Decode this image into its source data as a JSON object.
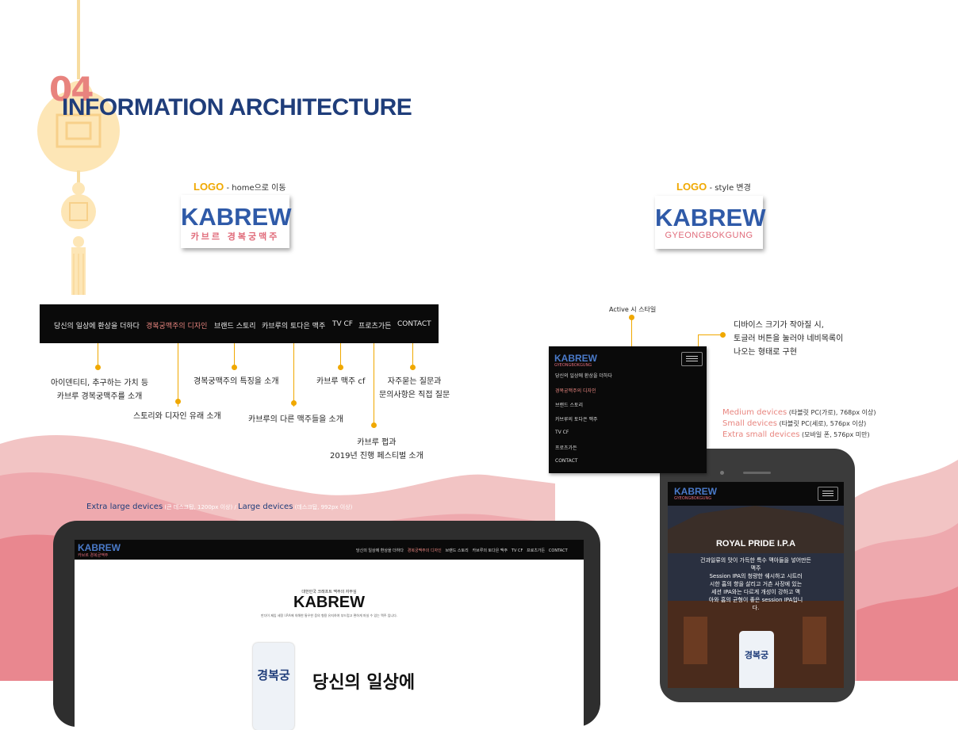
{
  "section": {
    "number": "04",
    "title": "INFORMATION ARCHITECTURE"
  },
  "logo_left": {
    "caption_label": "LOGO",
    "caption_text": " - home으로 이동",
    "main": "KABREW",
    "sub": "카브르 경복궁맥주"
  },
  "logo_right": {
    "caption_label": "LOGO",
    "caption_text": " - style 변경",
    "main": "KABREW",
    "sub": "GYEONGBOKGUNG"
  },
  "nav": {
    "items": [
      "당신의 일상에 환상을 더하다",
      "경복궁맥주의 디자인",
      "브랜드 스토리",
      "카브루의 토다은 맥주",
      "TV CF",
      "프로츠가든",
      "CONTACT"
    ],
    "active_index": 1
  },
  "annotations": {
    "a1_l1": "아이덴티티, 추구하는 가치 등",
    "a1_l2": "카브루 경복궁맥주를 소개",
    "a2": "스토리와 디자인 유래 소개",
    "a3": "경복궁맥주의 특징을 소개",
    "a4": "카브루의 다른 맥주들을 소개",
    "a5": "카브루 맥주 cf",
    "a6_l1": "카브루 펍과",
    "a6_l2": "2019년 진행 페스티벌 소개",
    "a7_l1": "자주묻는 질문과",
    "a7_l2": "문의사항은 직접 질문"
  },
  "mobile": {
    "active_label": "Active 시 스타일",
    "toggle_note_l1": "디바이스 크기가 작아질 시,",
    "toggle_note_l2": "토글러 버튼을 눌러야 네비목록이",
    "toggle_note_l3": "나오는 형태로 구현",
    "logo": "KABREW",
    "logo_sub": "GYEONGBOKGUNG",
    "items": [
      "당신의 일상에 환상을 더하다",
      "경복궁맥주의 디자인",
      "브랜드 스토리",
      "카브루의 토다은 맥주",
      "TV CF",
      "프로츠가든",
      "CONTACT"
    ]
  },
  "devices": {
    "medium": "Medium devices",
    "medium_note": " (타블릿 PC(가로), 768px 이상)",
    "small": "Small devices",
    "small_note": " (타블릿 PC(세로), 576px 이상)",
    "xsmall": "Extra small devices",
    "xsmall_note": " (모바일 폰, 576px 미만)",
    "xl": "Extra large devices",
    "xl_note": " (큰 데스크탑, 1200px 이상) / ",
    "lg": "Large devices",
    "lg_note": " (데스크탑, 992px 이상)"
  },
  "laptop": {
    "logo": "KABREW",
    "logo_sub": "카브르 경복궁맥주",
    "nav": [
      "당신의 일상에 환상을 더하다",
      "경복궁맥주의 디자인",
      "브랜드 스토리",
      "카브루의 토다은 맥주",
      "TV CF",
      "프로츠가든",
      "CONTACT"
    ],
    "hero_kicker": "대한민국 크래프트 맥주의 자부심",
    "hero_title": "KABREW",
    "hero_desc": "만다이 제임 세정 I.P.A에 의해한 통우한 음의 형용 유지하여 부드럽고 편하게 마실 수 있는 맥주 입니다.",
    "can_text": "경복궁",
    "headline": "당신의 일상에"
  },
  "phone": {
    "logo": "KABREW",
    "logo_sub": "GYEONGBOKGUNG",
    "title": "ROYAL PRIDE I.P.A",
    "body_l1": "건과일류의 맛이 가득한 특수 맥아들을 넣어만든",
    "body_l2": "맥주",
    "body_l3": "Session IPA의 청량한 쉐시하고 시트러",
    "body_l4": "시한 홉의 향을 살리고 거츤 사장에 있는",
    "body_l5": "세션 IPA와는 다르게 개성이 강하고 맥",
    "body_l6": "아와 홉의 균형이 좋은 session IPA입니",
    "body_l7": "다.",
    "can_text": "경복궁"
  }
}
